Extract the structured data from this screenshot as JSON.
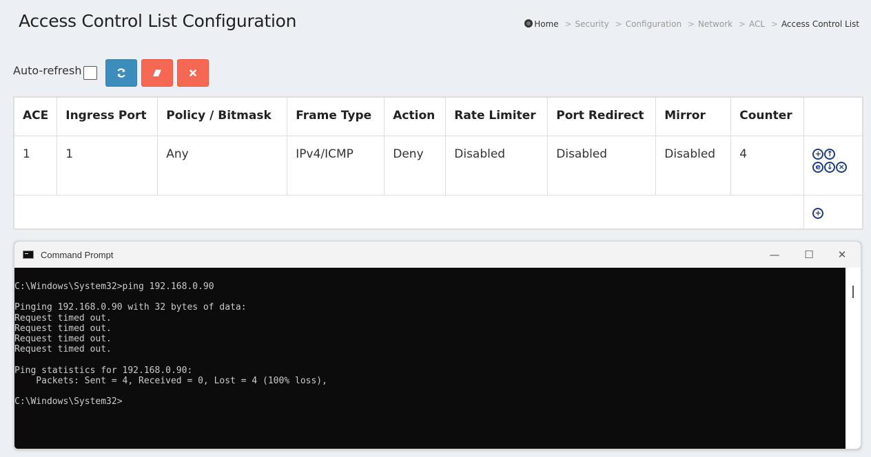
{
  "page": {
    "title": "Access Control List Configuration"
  },
  "breadcrumb": {
    "home": "Home",
    "items": [
      "Security",
      "Configuration",
      "Network",
      "ACL"
    ],
    "current": "Access Control List",
    "separator": ">"
  },
  "toolbar": {
    "auto_refresh_label": "Auto-refresh",
    "auto_refresh_checked": false,
    "buttons": [
      {
        "name": "refresh-button",
        "icon": "refresh-icon",
        "color": "#3c8dbc"
      },
      {
        "name": "clear-button",
        "icon": "eraser-icon",
        "color": "#f56954"
      },
      {
        "name": "remove-all-button",
        "icon": "close-icon",
        "color": "#f56954"
      }
    ]
  },
  "ace_table": {
    "columns": [
      "ACE",
      "Ingress Port",
      "Policy / Bitmask",
      "Frame Type",
      "Action",
      "Rate Limiter",
      "Port Redirect",
      "Mirror",
      "Counter",
      ""
    ],
    "rows": [
      {
        "ace": "1",
        "ingress_port": "1",
        "policy_bitmask": "Any",
        "frame_type": "IPv4/ICMP",
        "action": "Deny",
        "rate_limiter": "Disabled",
        "port_redirect": "Disabled",
        "mirror": "Disabled",
        "counter": "4",
        "controls": [
          "insert-icon",
          "move-up-icon",
          "edit-icon",
          "move-down-icon",
          "delete-icon"
        ]
      }
    ],
    "add_row_control": "insert-icon"
  },
  "command_prompt": {
    "title": "Command Prompt",
    "window_controls": {
      "minimize": "—",
      "maximize": "☐",
      "close": "✕"
    },
    "lines": [
      "C:\\Windows\\System32>ping 192.168.0.90",
      "",
      "Pinging 192.168.0.90 with 32 bytes of data:",
      "Request timed out.",
      "Request timed out.",
      "Request timed out.",
      "Request timed out.",
      "",
      "Ping statistics for 192.168.0.90:",
      "    Packets: Sent = 4, Received = 0, Lost = 4 (100% loss),",
      "",
      "C:\\Windows\\System32>"
    ]
  },
  "colors": {
    "page_background": "#ecf0f5",
    "button_blue": "#3c8dbc",
    "button_red": "#f56954",
    "control_icon": "#1a3a8c",
    "terminal_background": "#0c0c0c",
    "terminal_text": "#cccccc"
  }
}
